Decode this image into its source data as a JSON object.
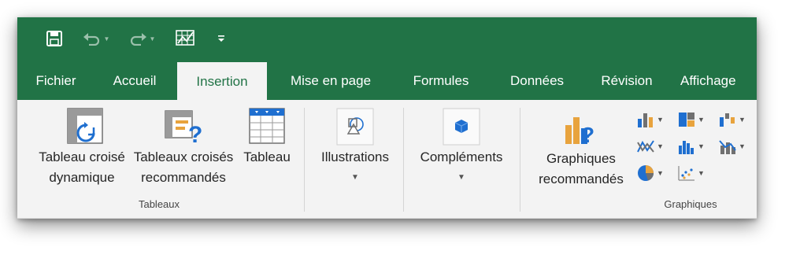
{
  "quick_access": {
    "save_icon": "save-icon",
    "undo_icon": "undo-icon",
    "redo_icon": "redo-icon",
    "customize_icon": "customize-qat-icon"
  },
  "tabs": [
    {
      "label": "Fichier"
    },
    {
      "label": "Accueil"
    },
    {
      "label": "Insertion",
      "active": true
    },
    {
      "label": "Mise en page"
    },
    {
      "label": "Formules"
    },
    {
      "label": "Données"
    },
    {
      "label": "Révision"
    },
    {
      "label": "Affichage"
    }
  ],
  "groups": {
    "tableaux": {
      "label": "Tableaux",
      "pivot_line1": "Tableau croisé",
      "pivot_line2": "dynamique",
      "recommended_line1": "Tableaux croisés",
      "recommended_line2": "recommandés",
      "table": "Tableau"
    },
    "illustrations": {
      "label": "Illustrations"
    },
    "complements": {
      "label": "Compléments"
    },
    "graphiques": {
      "label": "Graphiques",
      "recommended_line1": "Graphiques",
      "recommended_line2": "recommandés"
    }
  },
  "colors": {
    "brand_green": "#217346",
    "ribbon_bg": "#f3f3f3",
    "accent_blue": "#1f6fd0",
    "accent_orange": "#e8a33d"
  }
}
